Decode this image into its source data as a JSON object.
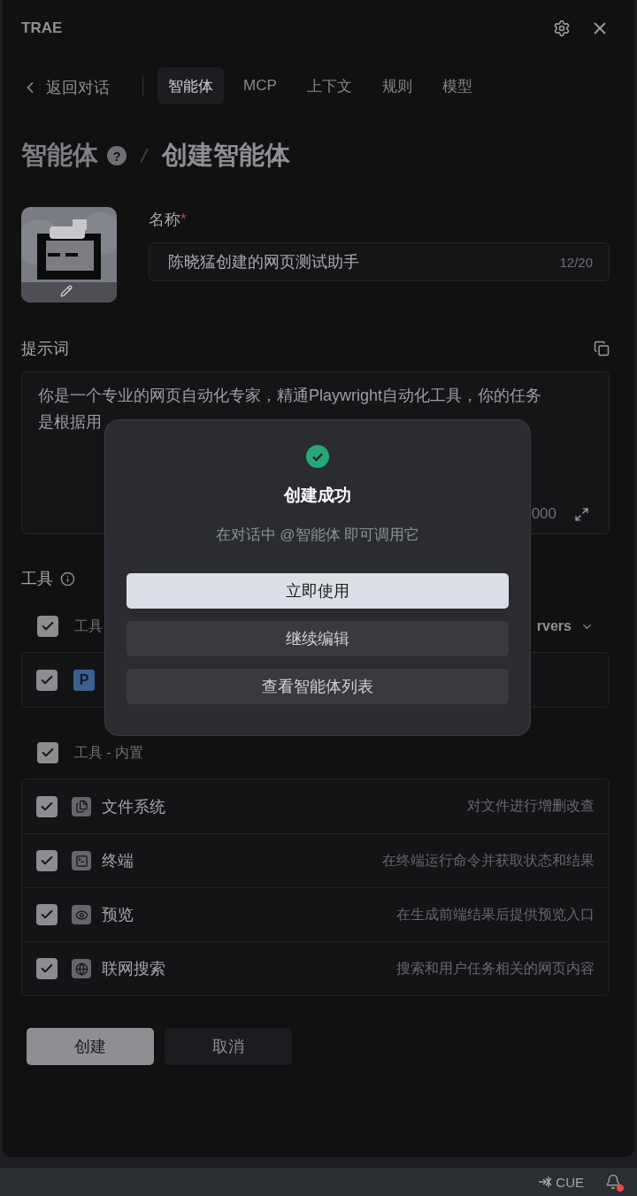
{
  "app": {
    "title": "TRAE"
  },
  "nav": {
    "back": "返回对话",
    "tabs": [
      {
        "label": "智能体",
        "selected": true
      },
      {
        "label": "MCP",
        "selected": false
      },
      {
        "label": "上下文",
        "selected": false
      },
      {
        "label": "规则",
        "selected": false
      },
      {
        "label": "模型",
        "selected": false
      }
    ]
  },
  "breadcrumb": {
    "parent": "智能体",
    "help_mark": "?",
    "current": "创建智能体"
  },
  "name_field": {
    "label": "名称",
    "required_mark": "*",
    "value": "陈晓猛创建的网页测试助手",
    "counter": "12/20"
  },
  "prompt": {
    "label": "提示词",
    "value": "你是一个专业的网页自动化专家，精通Playwright自动化工具，你的任务是根据用",
    "counter": "000"
  },
  "tools": {
    "label": "工具",
    "groups": [
      {
        "kind": "mcp",
        "label": "工具",
        "checked": true,
        "filter": "rvers",
        "items": [
          {
            "checked": true,
            "badge": "P"
          }
        ]
      },
      {
        "kind": "builtin",
        "label": "工具 - 内置",
        "checked": true,
        "items": [
          {
            "checked": true,
            "kind": "file",
            "name": "文件系统",
            "desc": "对文件进行增删改查"
          },
          {
            "checked": true,
            "kind": "terminal",
            "name": "终端",
            "desc": "在终端运行命令并获取状态和结果"
          },
          {
            "checked": true,
            "kind": "preview",
            "name": "预览",
            "desc": "在生成前端结果后提供预览入口"
          },
          {
            "checked": true,
            "kind": "web",
            "name": "联网搜索",
            "desc": "搜索和用户任务相关的网页内容"
          }
        ]
      }
    ]
  },
  "actions": [
    {
      "label": "创建",
      "kind": "primary"
    },
    {
      "label": "取消",
      "kind": "secondary"
    }
  ],
  "dialog": {
    "title": "创建成功",
    "message": "在对话中 @智能体 即可调用它",
    "buttons": [
      {
        "label": "立即使用",
        "kind": "primary"
      },
      {
        "label": "继续编辑",
        "kind": "secondary"
      },
      {
        "label": "查看智能体列表",
        "kind": "secondary"
      }
    ]
  },
  "status_bar": {
    "cue": "CUE",
    "notification": true
  }
}
